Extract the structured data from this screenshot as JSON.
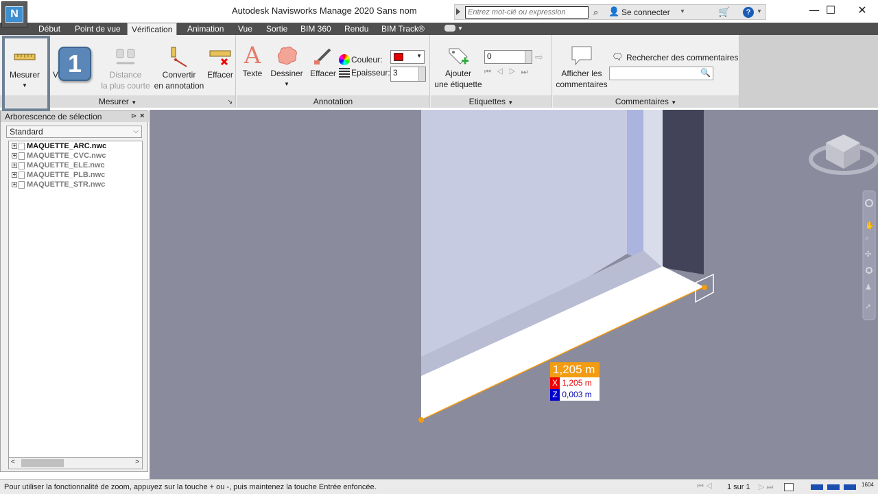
{
  "window": {
    "title": "Autodesk Navisworks Manage 2020",
    "document": "Sans nom",
    "app_button": "N",
    "minimize_icon": "minimize-icon",
    "maximize_icon": "maximize-icon",
    "close_icon": "close-icon"
  },
  "infocenter": {
    "search_placeholder": "Entrez mot-clé ou expression",
    "signin_label": "Se connecter",
    "help_label": "?"
  },
  "tabs": [
    {
      "label": "Début",
      "active": false
    },
    {
      "label": "Point de vue",
      "active": false
    },
    {
      "label": "Vérification",
      "active": true
    },
    {
      "label": "Animation",
      "active": false
    },
    {
      "label": "Vue",
      "active": false
    },
    {
      "label": "Sortie",
      "active": false
    },
    {
      "label": "BIM 360",
      "active": false
    },
    {
      "label": "Rendu",
      "active": false
    },
    {
      "label": "BIM Track®",
      "active": false
    }
  ],
  "ribbon": {
    "mesurer_panel": {
      "title": "Mesurer",
      "measure_label": "Mesurer",
      "v_label": "V",
      "distance_line1": "Distance",
      "distance_line2": "la plus courte",
      "convert_line1": "Convertir",
      "convert_line2": "en annotation",
      "erase_label": "Effacer"
    },
    "annotation_panel": {
      "title": "Annotation",
      "text_label": "Texte",
      "draw_label": "Dessiner",
      "erase_label": "Effacer",
      "color_label": "Couleur:",
      "thickness_label": "Epaisseur:",
      "thickness_value": "3",
      "color_value": "#e00000"
    },
    "etiquettes_panel": {
      "title": "Etiquettes",
      "add_line1": "Ajouter",
      "add_line2": "une étiquette",
      "tag_value": "0"
    },
    "comments_panel": {
      "title": "Commentaires",
      "show_line1": "Afficher les",
      "show_line2": "commentaires",
      "search_label": "Rechercher des commentaires"
    },
    "step_badge": "1"
  },
  "selection_tree": {
    "title": "Arborescence de sélection",
    "dropdown_value": "Standard",
    "items": [
      {
        "label": "MAQUETTE_ARC.nwc"
      },
      {
        "label": "MAQUETTE_CVC.nwc"
      },
      {
        "label": "MAQUETTE_ELE.nwc"
      },
      {
        "label": "MAQUETTE_PLB.nwc"
      },
      {
        "label": "MAQUETTE_STR.nwc"
      }
    ]
  },
  "measurement": {
    "total": "1,205 m",
    "x_label": "X",
    "x_value": "1,205 m",
    "z_label": "Z",
    "z_value": "0,003 m",
    "accent_color": "#f39c12"
  },
  "statusbar": {
    "message": "Pour utiliser la fonctionnalité de zoom, appuyez sur la touche + ou -, puis maintenez la touche Entrée enfoncée.",
    "page": "1 sur 1",
    "memory": "1604"
  }
}
